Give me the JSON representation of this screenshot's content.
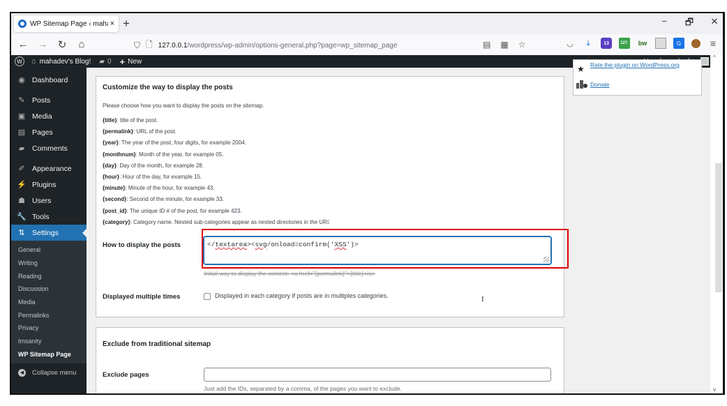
{
  "browser": {
    "tab_title": "WP Sitemap Page ‹ mahadev's Blog! — WordPress",
    "tab_title_visible": "WP Sitemap Page ‹ mahadev's E",
    "tab_close": "×",
    "new_tab": "+",
    "window_controls": {
      "minimize": "−",
      "restore": "🗗",
      "close": "✕"
    },
    "nav": {
      "back": "←",
      "forward": "→",
      "reload": "↻",
      "home": "⌂"
    },
    "url_host": "127.0.0.1",
    "url_path": "/wordpress/wp-admin/options-general.php?page=wp_sitemap_page",
    "url_icons": [
      "reader-view-icon",
      "translate-icon",
      "bookmark-star-icon"
    ],
    "extensions": {
      "purple_badge": "13",
      "green_badge": "127.",
      "bw_label": "bw",
      "translate_label": "G"
    }
  },
  "adminbar": {
    "site_name": "mahadev's Blog!",
    "comments_count": "0",
    "new_label": "New",
    "howdy": "Howdy, mahadev"
  },
  "sidebar": {
    "items": [
      {
        "label": "Dashboard",
        "icon": "dashboard-icon",
        "glyph": "◉"
      },
      {
        "label": "Posts",
        "icon": "pin-icon",
        "glyph": "✎"
      },
      {
        "label": "Media",
        "icon": "media-icon",
        "glyph": "▣"
      },
      {
        "label": "Pages",
        "icon": "pages-icon",
        "glyph": "▤"
      },
      {
        "label": "Comments",
        "icon": "comment-icon",
        "glyph": "▰"
      },
      {
        "label": "Appearance",
        "icon": "brush-icon",
        "glyph": "✐"
      },
      {
        "label": "Plugins",
        "icon": "plugin-icon",
        "glyph": "⚡"
      },
      {
        "label": "Users",
        "icon": "user-icon",
        "glyph": "☗"
      },
      {
        "label": "Tools",
        "icon": "wrench-icon",
        "glyph": "🔧"
      },
      {
        "label": "Settings",
        "icon": "settings-icon",
        "glyph": "⇅"
      }
    ],
    "submenu": [
      "General",
      "Writing",
      "Reading",
      "Discussion",
      "Media",
      "Permalinks",
      "Privacy",
      "Imsanity",
      "WP Sitemap Page"
    ],
    "current_submenu": "WP Sitemap Page",
    "collapse_label": "Collapse menu"
  },
  "side_box": {
    "rate_link": "Rate the plugin on WordPress.org",
    "donate_link": "Donate"
  },
  "posts_box": {
    "title": "Customize the way to display the posts",
    "intro": "Please choose how you want to display the posts on the sitemap.",
    "placeholders": [
      {
        "key": "{title}",
        "desc": ": title of the post."
      },
      {
        "key": "{permalink}",
        "desc": ": URL of the post."
      },
      {
        "key": "{year}",
        "desc": ": The year of the post, four digits, for example 2004."
      },
      {
        "key": "{monthnum}",
        "desc": ": Month of the year, for example 05."
      },
      {
        "key": "{day}",
        "desc": ": Day of the month, for example 28."
      },
      {
        "key": "{hour}",
        "desc": ": Hour of the day, for example 15."
      },
      {
        "key": "{minute}",
        "desc": ": Minute of the hour, for example 43."
      },
      {
        "key": "{second}",
        "desc": ": Second of the minute, for example 33."
      },
      {
        "key": "{post_id}",
        "desc": ": The unique ID # of the post, for example 423."
      },
      {
        "key": "{category}",
        "desc": ": Category name. Nested sub-categories appear as nested directories in the URI."
      }
    ],
    "display_label": "How to display the posts",
    "display_value_parts": [
      "</",
      "textarea",
      "><",
      "svg",
      "/onload=confirm('",
      "XSS",
      "')>"
    ],
    "display_hint": "Initial way to display the content: <a href=\"{permalink}\">{title}</a>",
    "multiple_label": "Displayed multiple times",
    "multiple_checkbox_label": "Displayed in each category if posts are in multiples categories.",
    "multiple_checked": false
  },
  "exclude_box": {
    "title": "Exclude from traditional sitemap",
    "pages_label": "Exclude pages",
    "pages_value": "",
    "pages_hint": "Just add the IDs, separated by a comma, of the pages you want to exclude."
  },
  "colors": {
    "highlight": "#e00000",
    "accent": "#2271b1",
    "adminbar": "#1d2327"
  }
}
